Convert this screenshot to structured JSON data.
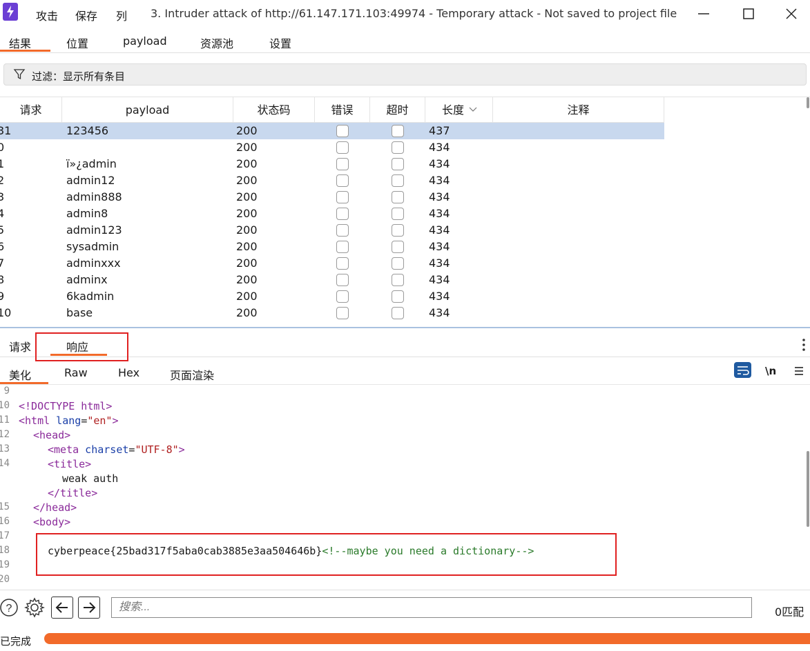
{
  "titlebar": {
    "menu": [
      "攻击",
      "保存",
      "列"
    ],
    "title": "3. Intruder attack of http://61.147.171.103:49974 - Temporary attack - Not saved to project file"
  },
  "tabs": [
    "结果",
    "位置",
    "payload",
    "资源池",
    "设置"
  ],
  "filter": {
    "text": "过滤：显示所有条目"
  },
  "table": {
    "columns": [
      "请求",
      "payload",
      "状态码",
      "错误",
      "超时",
      "长度",
      "注释"
    ],
    "rows": [
      {
        "req": "31",
        "payload": "123456",
        "status": "200",
        "length": "437"
      },
      {
        "req": "0",
        "payload": "",
        "status": "200",
        "length": "434"
      },
      {
        "req": "1",
        "payload": "ï»¿admin",
        "status": "200",
        "length": "434"
      },
      {
        "req": "2",
        "payload": "admin12",
        "status": "200",
        "length": "434"
      },
      {
        "req": "3",
        "payload": "admin888",
        "status": "200",
        "length": "434"
      },
      {
        "req": "4",
        "payload": "admin8",
        "status": "200",
        "length": "434"
      },
      {
        "req": "5",
        "payload": "admin123",
        "status": "200",
        "length": "434"
      },
      {
        "req": "6",
        "payload": "sysadmin",
        "status": "200",
        "length": "434"
      },
      {
        "req": "7",
        "payload": "adminxxx",
        "status": "200",
        "length": "434"
      },
      {
        "req": "8",
        "payload": "adminx",
        "status": "200",
        "length": "434"
      },
      {
        "req": "9",
        "payload": "6kadmin",
        "status": "200",
        "length": "434"
      },
      {
        "req": "10",
        "payload": "base",
        "status": "200",
        "length": "434"
      }
    ]
  },
  "lower_tabs": [
    "请求",
    "响应"
  ],
  "sub_tabs": [
    "美化",
    "Raw",
    "Hex",
    "页面渲染"
  ],
  "toolbar": {
    "newline_label": "\\n"
  },
  "code": {
    "line_numbers": [
      "9",
      "10",
      "11",
      "12",
      "13",
      "14",
      "15",
      "16",
      "17",
      "18",
      "19",
      "20"
    ],
    "doctype": "<!DOCTYPE html>",
    "html_open": "<html",
    "lang_attr": " lang",
    "lang_eq": "=",
    "lang_val": "\"en\"",
    "gt": ">",
    "head_open": "<head>",
    "meta_open": "<meta",
    "charset_attr": " charset",
    "charset_val": "\"UTF-8\"",
    "title_open": "<title>",
    "title_text": "weak auth",
    "title_close": "</title>",
    "head_close": "</head>",
    "body_open": "<body>",
    "flag": "cyberpeace{25bad317f5aba0cab3885e3aa504646b}",
    "comment": "<!--maybe you need a dictionary-->"
  },
  "search": {
    "placeholder": "搜索...",
    "matches": "0匹配"
  },
  "status": {
    "text": "已完成"
  },
  "colors": {
    "accent": "#f26a2a",
    "logo": "#6b3fd4",
    "highlight": "#e02020",
    "selected_row": "#c8d8ee"
  }
}
